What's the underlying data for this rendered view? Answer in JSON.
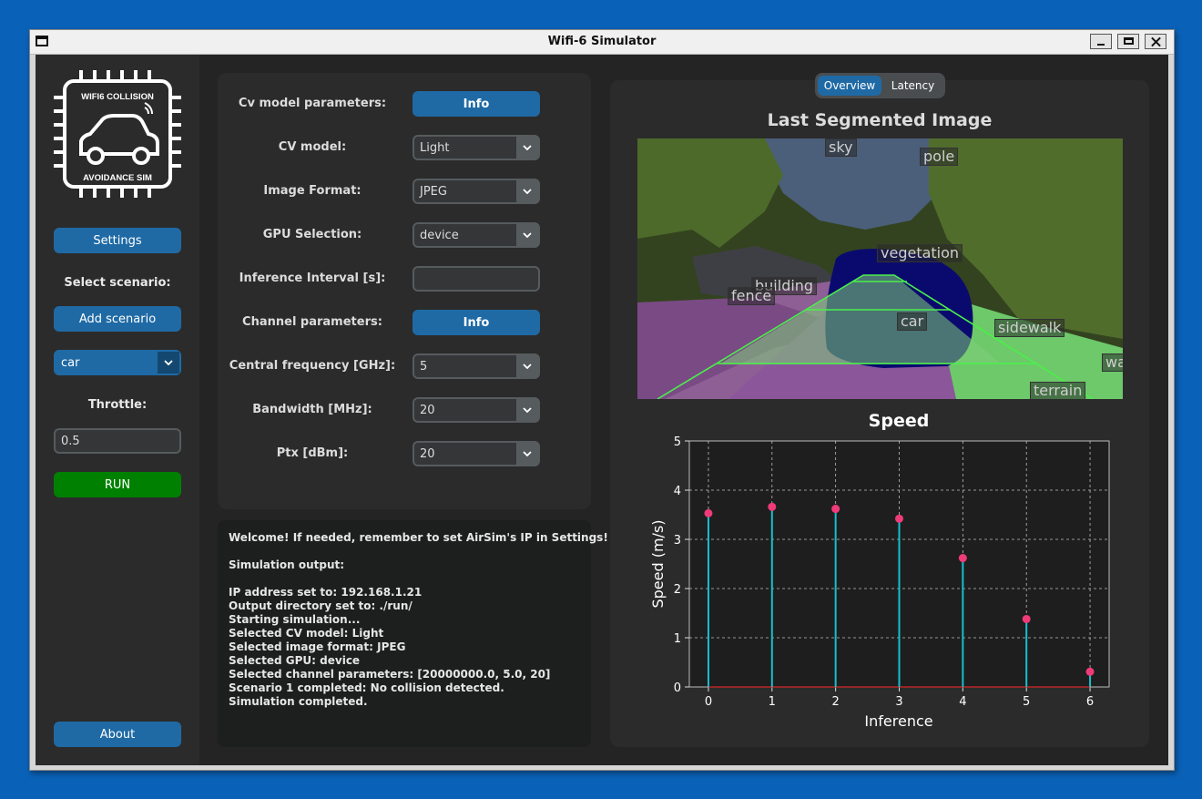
{
  "window": {
    "title": "Wifi-6 Simulator"
  },
  "sidebar": {
    "logo_top_text": "WIFI6 COLLISION",
    "logo_bottom_text": "AVOIDANCE SIM",
    "settings_button": "Settings",
    "select_scenario_label": "Select scenario:",
    "add_scenario_button": "Add scenario",
    "scenario_value": "car",
    "throttle_label": "Throttle:",
    "throttle_value": "0.5",
    "run_button": "RUN",
    "about_button": "About",
    "run_color": "#008000",
    "accent_color": "#1f6aa5"
  },
  "params": {
    "cv_params_label": "Cv model parameters:",
    "cv_info_button": "Info",
    "cv_model_label": "CV model:",
    "cv_model_value": "Light",
    "image_format_label": "Image Format:",
    "image_format_value": "JPEG",
    "gpu_label": "GPU Selection:",
    "gpu_value": "device",
    "inference_label": "Inference Interval [s]:",
    "inference_value": "",
    "channel_params_label": "Channel parameters:",
    "channel_info_button": "Info",
    "freq_label": "Central frequency [GHz]:",
    "freq_value": "5",
    "bandwidth_label": "Bandwidth [MHz]:",
    "bandwidth_value": "20",
    "ptx_label": "Ptx [dBm]:",
    "ptx_value": "20"
  },
  "console": {
    "lines": [
      "Welcome! If needed, remember to set AirSim's IP in Settings!",
      "Simulation output:",
      "IP address set to: 192.168.1.21",
      "Output directory set to: ./run/",
      "Starting simulation...",
      "Selected CV model: Light",
      "Selected image format: JPEG",
      "Selected GPU: device",
      "Selected channel parameters: [20000000.0, 5.0, 20]",
      "Scenario 1 completed: No collision detected.",
      "Simulation completed."
    ]
  },
  "right": {
    "tabs": [
      "Overview",
      "Latency"
    ],
    "active_tab": "Overview",
    "segmented_title": "Last Segmented Image",
    "seg_labels": [
      "sky",
      "pole",
      "vegetation",
      "building",
      "fence",
      "car",
      "sidewalk",
      "wa",
      "terrain"
    ]
  },
  "chart_data": {
    "type": "stem",
    "title": "Speed",
    "xlabel": "Inference",
    "ylabel": "Speed (m/s)",
    "x": [
      0,
      1,
      2,
      3,
      4,
      5,
      6
    ],
    "values": [
      3.53,
      3.66,
      3.62,
      3.42,
      2.62,
      1.38,
      0.31
    ],
    "xticks": [
      0,
      1,
      2,
      3,
      4,
      5,
      6
    ],
    "yticks": [
      0,
      1,
      2,
      3,
      4,
      5
    ],
    "xlim": [
      -0.3,
      6.3
    ],
    "ylim": [
      0,
      5
    ],
    "grid": true,
    "stem_color": "#17becf",
    "marker_color": "#ef3b7a",
    "baseline_color": "#d62728"
  }
}
